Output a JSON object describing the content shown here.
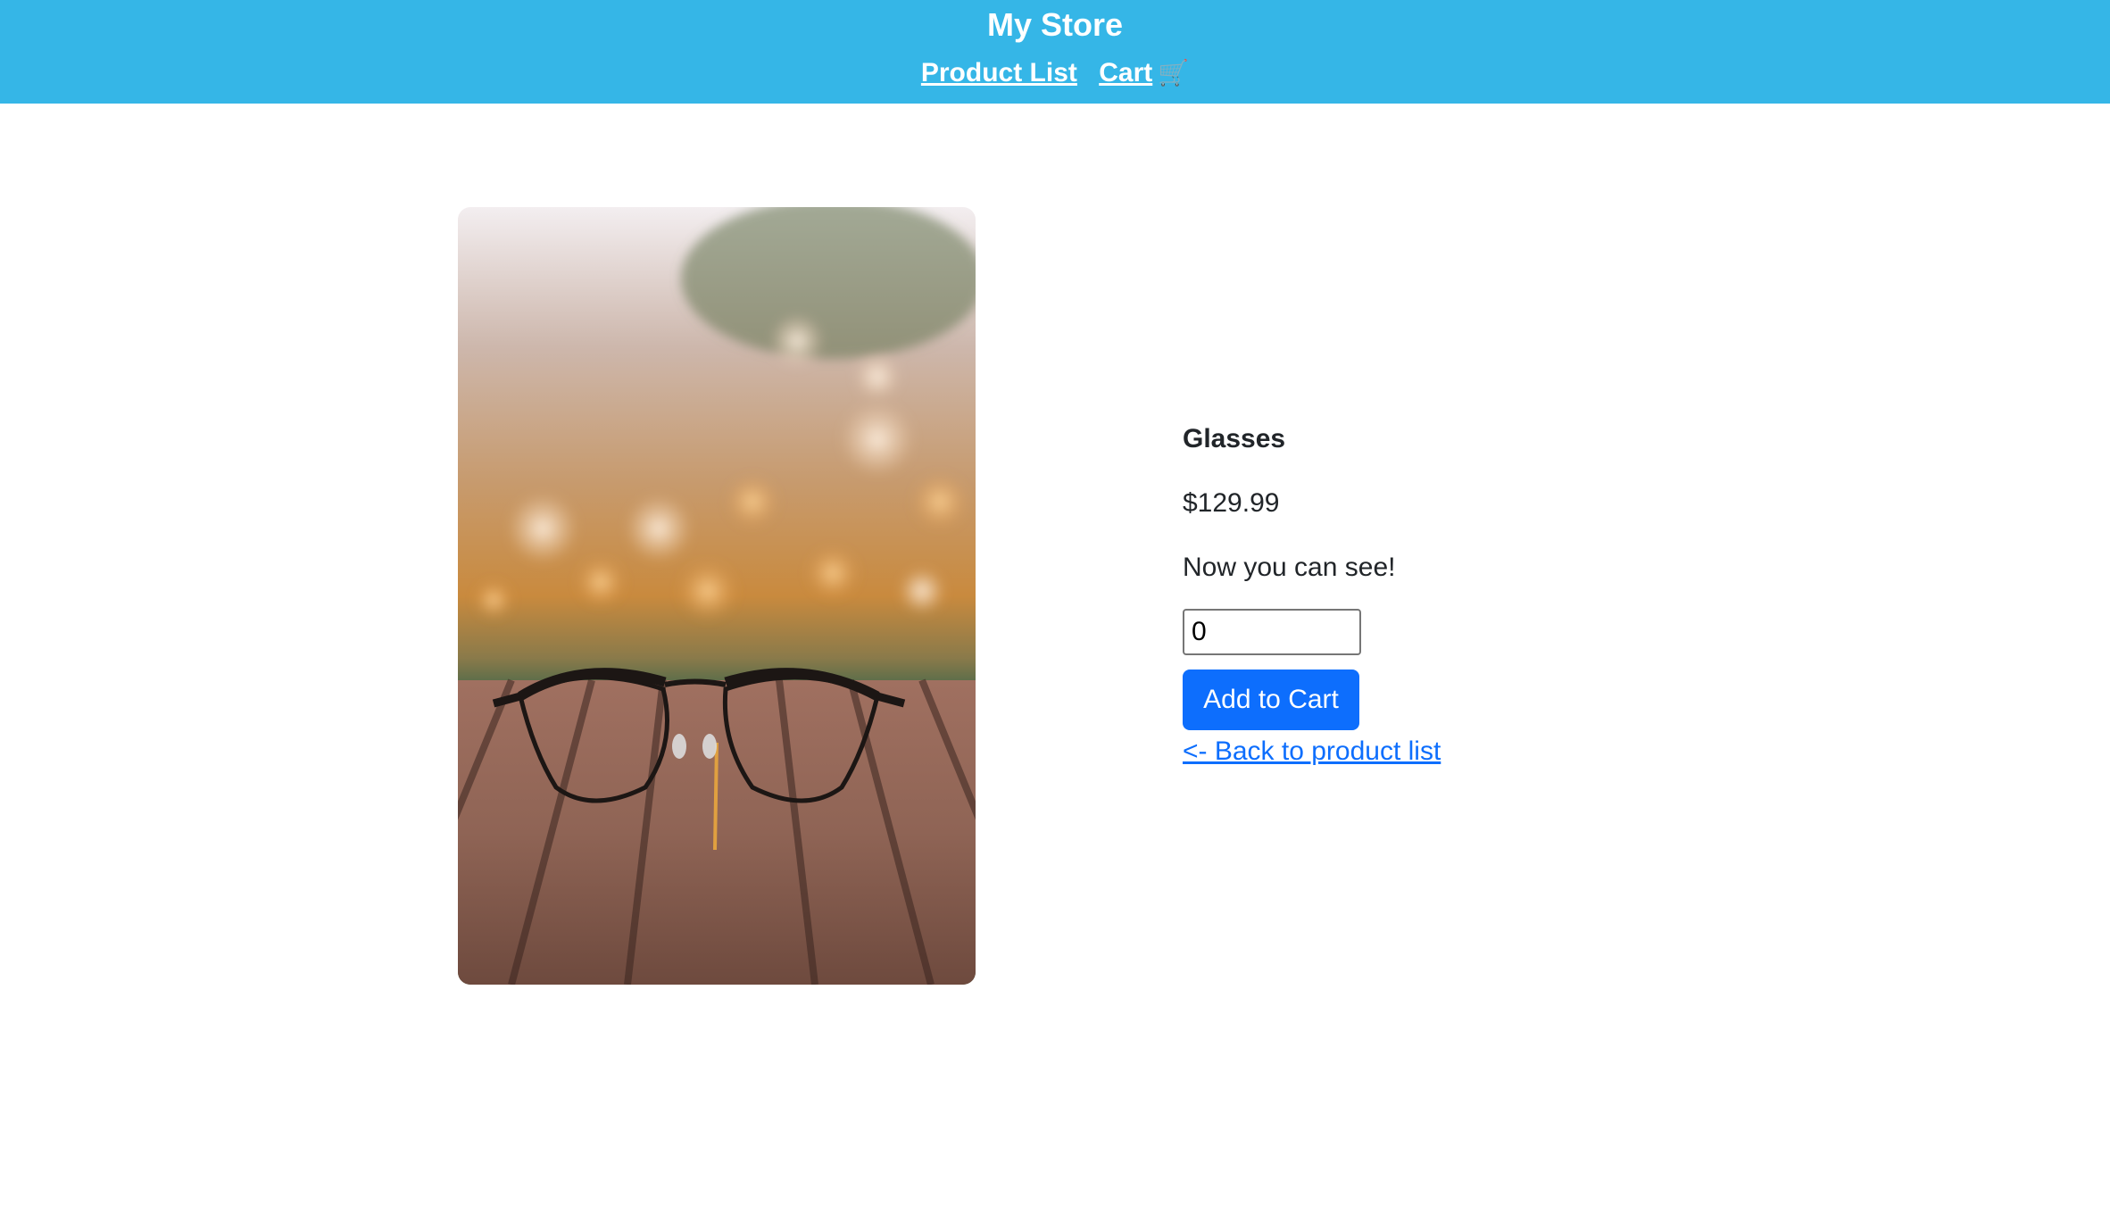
{
  "header": {
    "brand": "My Store",
    "nav": [
      {
        "label": "Product List"
      },
      {
        "label": "Cart",
        "icon": "shopping-cart-icon",
        "icon_glyph": "🛒"
      }
    ],
    "background_color": "#35b6e7"
  },
  "product": {
    "image": "glasses-photo",
    "name": "Glasses",
    "price": "$129.99",
    "description": "Now you can see!",
    "quantity_value": "0",
    "add_button_label": "Add to Cart",
    "back_link_label": "<- Back to product list"
  },
  "colors": {
    "primary_button": "#0d6efd",
    "link": "#0d6efd"
  }
}
